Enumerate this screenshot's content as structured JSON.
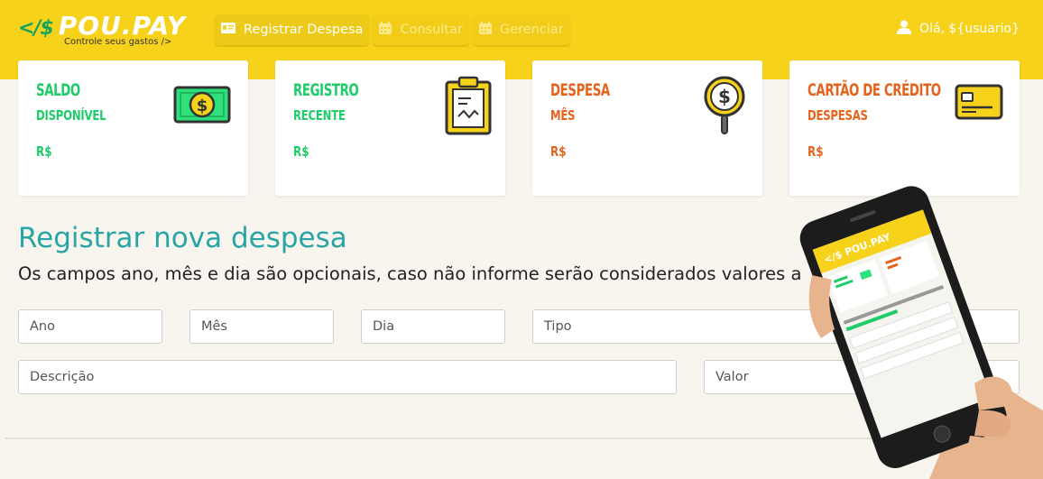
{
  "logo": {
    "code": "</$",
    "name": "POU.PAY",
    "tagline": "Controle seus gastos />"
  },
  "nav": {
    "items": [
      {
        "label": "Registrar Despesa",
        "icon": "id-card-icon"
      },
      {
        "label": "Consultar",
        "icon": "calendar-icon"
      },
      {
        "label": "Gerenciar",
        "icon": "calendar-icon"
      }
    ]
  },
  "user": {
    "greeting": "Olá, ${usuario}",
    "icon": "user-icon"
  },
  "cards": [
    {
      "title": "SALDO",
      "subtitle": "DISPONÍVEL",
      "value": "R$",
      "icon": "money-bill-icon",
      "color": "#1fcc6a"
    },
    {
      "title": "REGISTRO",
      "subtitle": "RECENTE",
      "value": "R$",
      "icon": "clipboard-icon",
      "color": "#1fcc6a"
    },
    {
      "title": "DESPESA",
      "subtitle": "MÊS",
      "value": "R$",
      "icon": "dollar-search-icon",
      "color": "#e5631d"
    },
    {
      "title": "CARTÃO DE CRÉDITO",
      "subtitle": "DESPESAS",
      "value": "R$",
      "icon": "credit-card-icon",
      "color": "#e5631d"
    }
  ],
  "form": {
    "title": "Registrar nova despesa",
    "subtitle": "Os campos ano, mês e dia são opcionais, caso não informe serão considerados valores a",
    "fields": {
      "ano": "Ano",
      "mes": "Mês",
      "dia": "Dia",
      "tipo": "Tipo",
      "descricao": "Descrição",
      "valor": "Valor"
    }
  },
  "colors": {
    "header": "#f7d21a",
    "accent": "#2aa5a5",
    "green": "#1fcc6a",
    "orange": "#e5631d"
  }
}
